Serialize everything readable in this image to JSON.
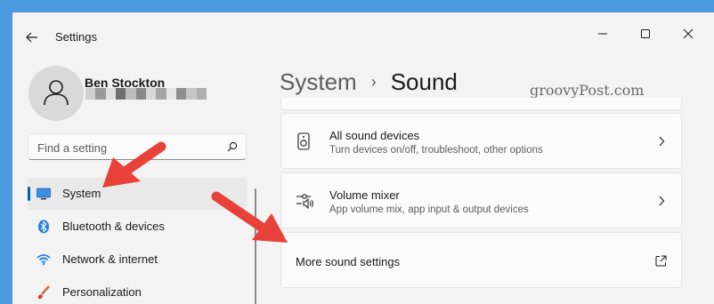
{
  "window": {
    "title": "Settings",
    "controls": [
      "minimize",
      "maximize",
      "close"
    ]
  },
  "profile": {
    "name": "Ben Stockton",
    "email_redacted": true
  },
  "search": {
    "placeholder": "Find a setting"
  },
  "nav": {
    "items": [
      {
        "label": "System",
        "icon": "monitor-icon",
        "selected": true
      },
      {
        "label": "Bluetooth & devices",
        "icon": "bluetooth-icon",
        "selected": false
      },
      {
        "label": "Network & internet",
        "icon": "wifi-icon",
        "selected": false
      },
      {
        "label": "Personalization",
        "icon": "brush-icon",
        "selected": false
      }
    ]
  },
  "breadcrumb": {
    "parent": "System",
    "separator": "›",
    "current": "Sound"
  },
  "cards": [
    {
      "title": "",
      "subtitle": ""
    },
    {
      "title": "All sound devices",
      "subtitle": "Turn devices on/off, troubleshoot, other options",
      "icon": "speaker-icon"
    },
    {
      "title": "Volume mixer",
      "subtitle": "App volume mix, app input & output devices",
      "icon": "mixer-icon"
    },
    {
      "title": "More sound settings",
      "subtitle": "",
      "icon": "external-link-icon"
    }
  ],
  "watermark": "groovyPost.com",
  "colors": {
    "accent": "#005fb8",
    "annotation_arrow": "#e8413a",
    "desktop": "#4a9ae0"
  }
}
